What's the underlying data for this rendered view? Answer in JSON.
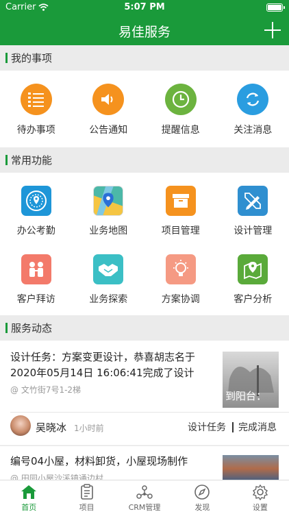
{
  "status": {
    "carrier": "Carrier",
    "time": "5:07 PM"
  },
  "nav": {
    "title": "易佳服务"
  },
  "sections": {
    "my_items": "我的事项",
    "common": "常用功能",
    "dynamics": "服务动态"
  },
  "my_items": [
    {
      "label": "待办事项",
      "icon": "todo-list-icon",
      "color": "#f5921e"
    },
    {
      "label": "公告通知",
      "icon": "speaker-icon",
      "color": "#f5921e"
    },
    {
      "label": "提醒信息",
      "icon": "clock-icon",
      "color": "#6cb33f"
    },
    {
      "label": "关注消息",
      "icon": "refresh-icon",
      "color": "#2a9de0"
    }
  ],
  "functions": [
    {
      "label": "办公考勤",
      "icon": "attendance-gauge-icon",
      "color": "#1e96d8"
    },
    {
      "label": "业务地图",
      "icon": "map-icon",
      "color": "#4cb8a8"
    },
    {
      "label": "项目管理",
      "icon": "box-icon",
      "color": "#f5921e"
    },
    {
      "label": "设计管理",
      "icon": "pencil-ruler-icon",
      "color": "#2f8fd0"
    },
    {
      "label": "客户拜访",
      "icon": "visit-people-icon",
      "color": "#f37a6a"
    },
    {
      "label": "业务探索",
      "icon": "handshake-icon",
      "color": "#3bbfc5"
    },
    {
      "label": "方案协调",
      "icon": "lightbulb-icon",
      "color": "#f59a83"
    },
    {
      "label": "客户分析",
      "icon": "map-pin-icon",
      "color": "#5aaa3a"
    }
  ],
  "feed": [
    {
      "text": "设计任务：方案变更设计，恭喜胡志名于2020年05月14日 16:06:41完成了设计",
      "location": "@ 文竹街7号1-2梯",
      "thumb_caption": "到阳台：",
      "user": "吴晓冰",
      "time": "1小时前",
      "tag1": "设计任务",
      "tag2": "完成消息"
    },
    {
      "text": "编号04小屋，材料卸货，小屋现场制作",
      "location": "@ 田园小屋沙溪镇通边村"
    }
  ],
  "tabs": [
    {
      "label": "首页",
      "icon": "home-icon",
      "active": true
    },
    {
      "label": "项目",
      "icon": "clipboard-icon"
    },
    {
      "label": "CRM管理",
      "icon": "crm-network-icon"
    },
    {
      "label": "发现",
      "icon": "compass-icon"
    },
    {
      "label": "设置",
      "icon": "gear-icon"
    }
  ],
  "colors": {
    "brand": "#1a9a3a",
    "section_bg": "#ebebeb"
  }
}
